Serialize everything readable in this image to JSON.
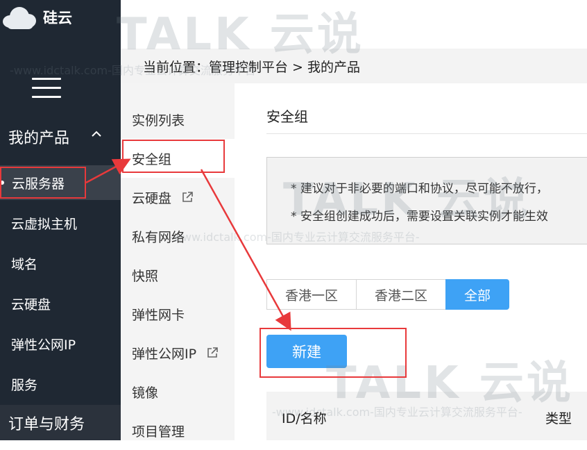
{
  "brand": {
    "name": "硅云"
  },
  "breadcrumb": {
    "text": "当前位置：管理控制平台 > 我的产品"
  },
  "left_nav": {
    "group_label": "我的产品",
    "items": [
      {
        "label": "云服务器",
        "active": true
      },
      {
        "label": "云虚拟主机"
      },
      {
        "label": "域名"
      },
      {
        "label": "云硬盘"
      },
      {
        "label": "弹性公网IP"
      },
      {
        "label": "服务"
      }
    ],
    "bottom_label": "订单与财务"
  },
  "submenu": {
    "items": [
      {
        "label": "实例列表"
      },
      {
        "label": "安全组",
        "active": true
      },
      {
        "label": "云硬盘",
        "external": true
      },
      {
        "label": "私有网络"
      },
      {
        "label": "快照"
      },
      {
        "label": "弹性网卡"
      },
      {
        "label": "弹性公网IP",
        "external": true
      },
      {
        "label": "镜像"
      },
      {
        "label": "项目管理"
      }
    ]
  },
  "main": {
    "title": "安全组",
    "notices": [
      "*  建议对于非必要的端口和协议，尽可能不放行，",
      "*  安全组创建成功后，需要设置关联实例才能生效"
    ],
    "region_tabs": [
      {
        "label": "香港一区"
      },
      {
        "label": "香港二区"
      },
      {
        "label": "全部",
        "active": true
      }
    ],
    "new_button": "新建",
    "table_headers": {
      "id_name": "ID/名称",
      "type": "类型"
    }
  },
  "watermark": {
    "big": "TALK 云说",
    "small": "-www.idctalk.com-国内专业云计算交流服务平台-"
  },
  "colors": {
    "sidebar_bg": "#1f2833",
    "accent_blue": "#3ea2f5",
    "highlight_red": "#e8393b"
  }
}
